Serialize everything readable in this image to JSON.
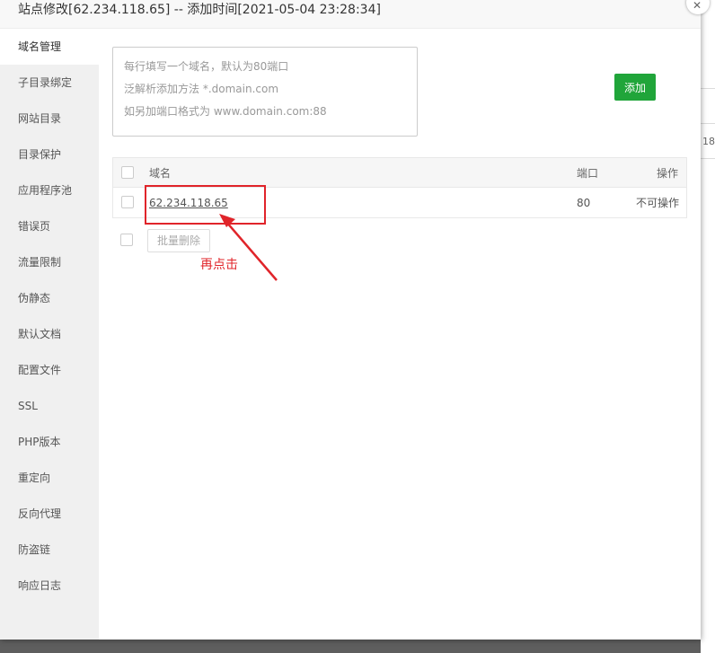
{
  "dialog": {
    "title": "站点修改[62.234.118.65] -- 添加时间[2021-05-04 23:28:34]",
    "close_symbol": "✕"
  },
  "background": {
    "partial_text": "18"
  },
  "sidebar": {
    "items": [
      {
        "label": "域名管理",
        "active": true
      },
      {
        "label": "子目录绑定"
      },
      {
        "label": "网站目录"
      },
      {
        "label": "目录保护"
      },
      {
        "label": "应用程序池"
      },
      {
        "label": "错误页"
      },
      {
        "label": "流量限制"
      },
      {
        "label": "伪静态"
      },
      {
        "label": "默认文档"
      },
      {
        "label": "配置文件"
      },
      {
        "label": "SSL"
      },
      {
        "label": "PHP版本"
      },
      {
        "label": "重定向"
      },
      {
        "label": "反向代理"
      },
      {
        "label": "防盗链"
      },
      {
        "label": "响应日志"
      }
    ]
  },
  "domain_input": {
    "placeholder_lines": [
      "每行填写一个域名，默认为80端口",
      "泛解析添加方法 *.domain.com",
      "如另加端口格式为 www.domain.com:88"
    ]
  },
  "add_button": {
    "label": "添加",
    "color": "#20a53a"
  },
  "table": {
    "headers": {
      "domain": "域名",
      "port": "端口",
      "action": "操作"
    },
    "rows": [
      {
        "domain": "62.234.118.65",
        "port": "80",
        "action": "不可操作"
      }
    ]
  },
  "batch_delete": {
    "label": "批量删除"
  },
  "annotation": {
    "text": "再点击",
    "color": "#e0242a"
  }
}
